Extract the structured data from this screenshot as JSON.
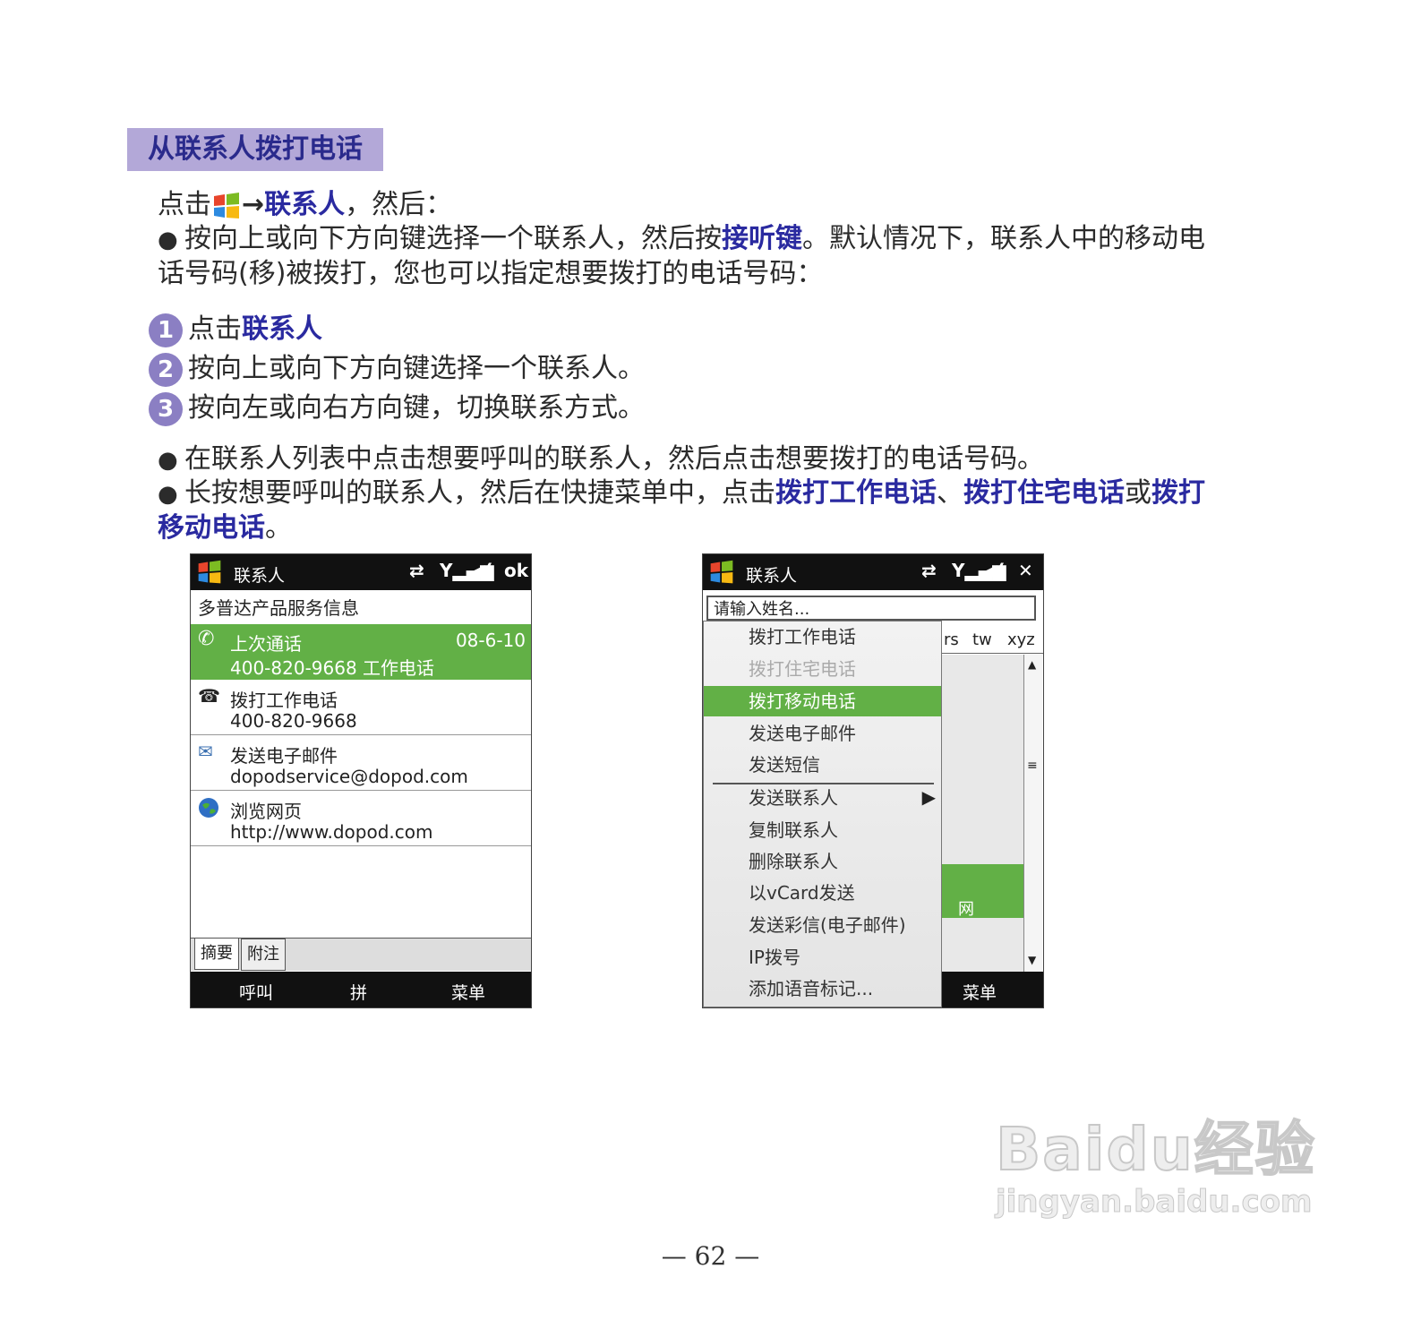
{
  "heading": "从联系人拨打电话",
  "intro": {
    "prefix": "点击",
    "arrow": "→",
    "link": "联系人",
    "suffix": "，然后："
  },
  "bullet1": {
    "a": "按向上或向下方向键选择一个联系人，然后按",
    "em": "接听键",
    "b": "。默认情况下，联系人中的移动电",
    "line2": "话号码(移)被拨打，您也可以指定想要拨打的电话号码："
  },
  "steps": [
    {
      "n": "1",
      "a": "点击",
      "em": "联系人",
      "b": ""
    },
    {
      "n": "2",
      "a": "按向上或向下方向键选择一个联系人。",
      "em": "",
      "b": ""
    },
    {
      "n": "3",
      "a": "按向左或向右方向键，切换联系方式。",
      "em": "",
      "b": ""
    }
  ],
  "bullet2": "在联系人列表中点击想要呼叫的联系人，然后点击想要拨打的电话号码。",
  "bullet3": {
    "a": "长按想要呼叫的联系人，然后在快捷菜单中，点击",
    "em1": "拨打工作电话",
    "sep": "、",
    "em2": "拨打住宅电话",
    "or": "或",
    "em3a": "拨打",
    "em3b": "移动电话",
    "end": "。"
  },
  "screen1": {
    "title": "联系人",
    "ok": "ok",
    "contact_name": "多普达产品服务信息",
    "last_call_label": "上次通话",
    "last_call_date": "08-6-10",
    "last_call_number": "400-820-9668 工作电话",
    "items": [
      {
        "label": "拨打工作电话",
        "value": "400-820-9668",
        "icon": "phone-icon"
      },
      {
        "label": "发送电子邮件",
        "value": "dopodservice@dopod.com",
        "icon": "email-icon"
      },
      {
        "label": "浏览网页",
        "value": "http://www.dopod.com",
        "icon": "globe-icon"
      }
    ],
    "tabs": [
      "摘要",
      "附注"
    ],
    "soft_left": "呼叫",
    "soft_mid": "拼",
    "soft_right": "菜单"
  },
  "screen2": {
    "title": "联系人",
    "search_placeholder": "请输入姓名...",
    "alpha_tabs": [
      "rs",
      "tw",
      "xyz"
    ],
    "net_label": "网",
    "soft_right": "菜单",
    "menu": [
      {
        "label": "拨打工作电话",
        "state": "normal"
      },
      {
        "label": "拨打住宅电话",
        "state": "disabled"
      },
      {
        "label": "拨打移动电话",
        "state": "selected"
      },
      {
        "label": "发送电子邮件",
        "state": "normal"
      },
      {
        "label": "发送短信",
        "state": "normal"
      },
      {
        "label": "发送联系人",
        "state": "normal"
      },
      {
        "label": "复制联系人",
        "state": "normal"
      },
      {
        "label": "删除联系人",
        "state": "normal"
      },
      {
        "label": "以vCard发送",
        "state": "normal"
      },
      {
        "label": "发送彩信(电子邮件)",
        "state": "normal"
      },
      {
        "label": "IP拨号",
        "state": "normal"
      },
      {
        "label": "添加语音标记...",
        "state": "normal"
      }
    ]
  },
  "watermark": {
    "brand": "Baidu经验",
    "url": "jingyan.baidu.com"
  },
  "page_number": "— 62 —"
}
